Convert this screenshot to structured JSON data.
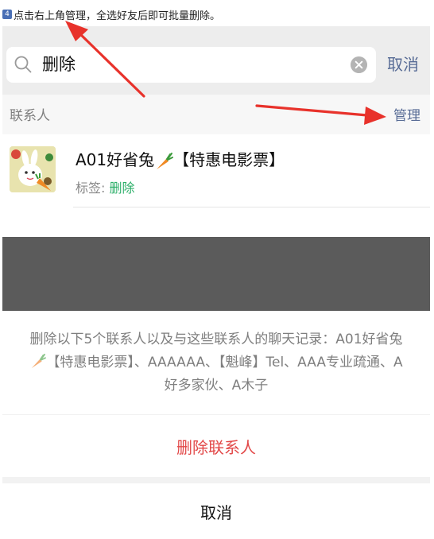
{
  "tutorial": {
    "step_number": "4",
    "caption": "点击右上角管理，全选好友后即可批量删除。"
  },
  "search": {
    "query": "删除",
    "cancel_label": "取消"
  },
  "section": {
    "label": "联系人",
    "manage_label": "管理"
  },
  "contact": {
    "name_prefix": "A01好省兔",
    "name_suffix": "【特惠电影票】",
    "tag_label": "标签: ",
    "tag_value": "删除"
  },
  "dialog": {
    "message_part1": "删除以下5个联系人以及与这些联系人的聊天记录：A01好省兔",
    "message_part2": "【特惠电影票】、AAAAAA、【魁峰】Tel、AAA专业疏通、A好多家伙、A木子",
    "delete_label": "删除联系人",
    "cancel_label": "取消"
  },
  "colors": {
    "link_blue": "#576b95",
    "tag_green": "#2aae67",
    "danger_red": "#e24848",
    "annotation_red": "#e8322b"
  },
  "icons": {
    "search": "search-icon",
    "clear": "clear-icon",
    "carrot": "carrot-emoji",
    "annotation": "red-arrow"
  }
}
